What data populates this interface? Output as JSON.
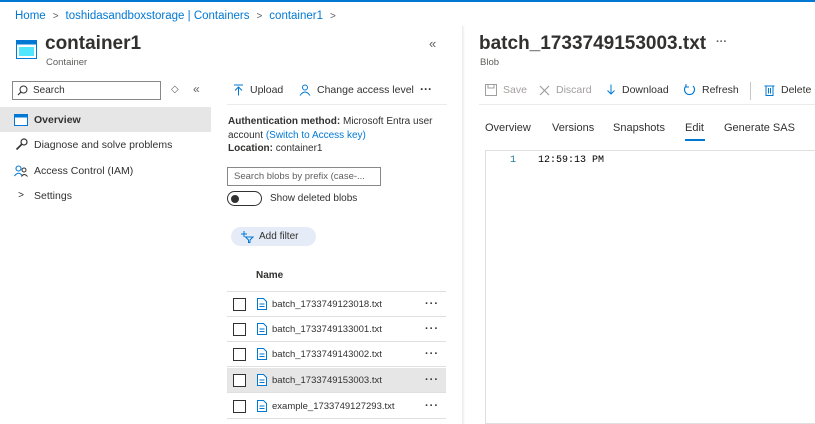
{
  "breadcrumb": {
    "items": [
      "Home",
      "toshidasandboxstorage | Containers",
      "container1"
    ]
  },
  "left_panel": {
    "title": "container1",
    "subtitle": "Container",
    "search_placeholder": "Search",
    "nav": [
      {
        "label": "Overview",
        "icon": "overview-icon",
        "active": true
      },
      {
        "label": "Diagnose and solve problems",
        "icon": "wrench-icon"
      },
      {
        "label": "Access Control (IAM)",
        "icon": "people-icon"
      },
      {
        "label": "Settings",
        "icon": "chevron-right-icon"
      }
    ]
  },
  "middle_panel": {
    "commands": {
      "upload": "Upload",
      "change_access": "Change access level",
      "more": "···"
    },
    "auth_label": "Authentication method:",
    "auth_value": "Microsoft Entra user",
    "auth_value2": "account",
    "auth_switch": "(Switch to Access key)",
    "location_label": "Location:",
    "location_value": "container1",
    "prefix_placeholder": "Search blobs by prefix (case-...",
    "show_deleted": "Show deleted blobs",
    "add_filter": "Add filter",
    "column_name": "Name",
    "rows": [
      {
        "name": "batch_1733749123018.txt",
        "selected": false
      },
      {
        "name": "batch_1733749133001.txt",
        "selected": false
      },
      {
        "name": "batch_1733749143002.txt",
        "selected": false
      },
      {
        "name": "batch_1733749153003.txt",
        "selected": true
      },
      {
        "name": "example_1733749127293.txt",
        "selected": false
      }
    ],
    "row_more": "···"
  },
  "right_panel": {
    "title": "batch_1733749153003.txt",
    "title_more": "···",
    "subtitle": "Blob",
    "toolbar": {
      "save": "Save",
      "discard": "Discard",
      "download": "Download",
      "refresh": "Refresh",
      "delete": "Delete"
    },
    "tabs": [
      "Overview",
      "Versions",
      "Snapshots",
      "Edit",
      "Generate SAS"
    ],
    "active_tab": "Edit",
    "editor": {
      "line_number": "1",
      "line_text": "12:59:13 PM"
    }
  },
  "colors": {
    "accent": "#0078d4",
    "selected_row": "#e6e6e6",
    "filter_pill": "#e5ecf7"
  }
}
